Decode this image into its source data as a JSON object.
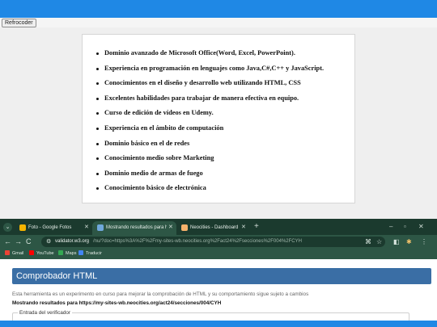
{
  "top_button": "Refrocoder",
  "skills": [
    "Dominio avanzado de Microsoft Office(Word, Excel, PowerPoint).",
    "Experiencia en programación en lenguajes como Java,C#,C++ y JavaScript.",
    "Conocimientos en el diseño y desarrollo web utilizando HTML, CSS",
    "Excelentes habilidades para trabajar de manera efectiva en equipo.",
    "Curso de edición de vídeos en Udemy.",
    "Experiencia en el ámbito de computación",
    "Dominio básico en el de redes",
    "Conocimiento medio sobre Marketing",
    "Dominio medio de armas de fuego",
    "Conocimiento básico de electrónica"
  ],
  "browser": {
    "tabs": [
      {
        "title": "Foto - Google Fotos",
        "active": false,
        "icon": "google-photos-icon",
        "color": "#f4b400"
      },
      {
        "title": "Mostrando resultados para htt",
        "active": true,
        "icon": "w3c-icon",
        "color": "#6fa8dc"
      },
      {
        "title": "Neocities - Dashboard",
        "active": false,
        "icon": "neocities-cat-icon",
        "color": "#f6b26b"
      }
    ],
    "url": {
      "domain": "validator.w3.org",
      "path": "/nu/?doc=https%3A%2F%2Fmy-sites-wb.neocities.org%2Fact24%2Fsecciones%2F004%2FCYH"
    },
    "bookmarks": [
      {
        "label": "Gmail",
        "icon": "gmail-icon",
        "color": "#ea4335"
      },
      {
        "label": "YouTube",
        "icon": "youtube-icon",
        "color": "#ff0000"
      },
      {
        "label": "Maps",
        "icon": "maps-icon",
        "color": "#34a853"
      },
      {
        "label": "Traducir",
        "icon": "translate-icon",
        "color": "#4285f4"
      }
    ]
  },
  "validator": {
    "heading": "Comprobador HTML",
    "intro": "Esta herramienta es un experimento en curso para mejorar la comprobación de HTML y su comportamiento sigue sujeto a cambios",
    "results": "Mostrando resultados para https://my-sites-wb.neocities.org/act24/secciones/004/CYH",
    "legend": "Entrada del verificador"
  },
  "colors": {
    "accent_blue": "#1f88e5",
    "browser_dark": "#1b3a2e",
    "browser_frame": "#2d5645",
    "validator_header": "#3a6ea5"
  }
}
